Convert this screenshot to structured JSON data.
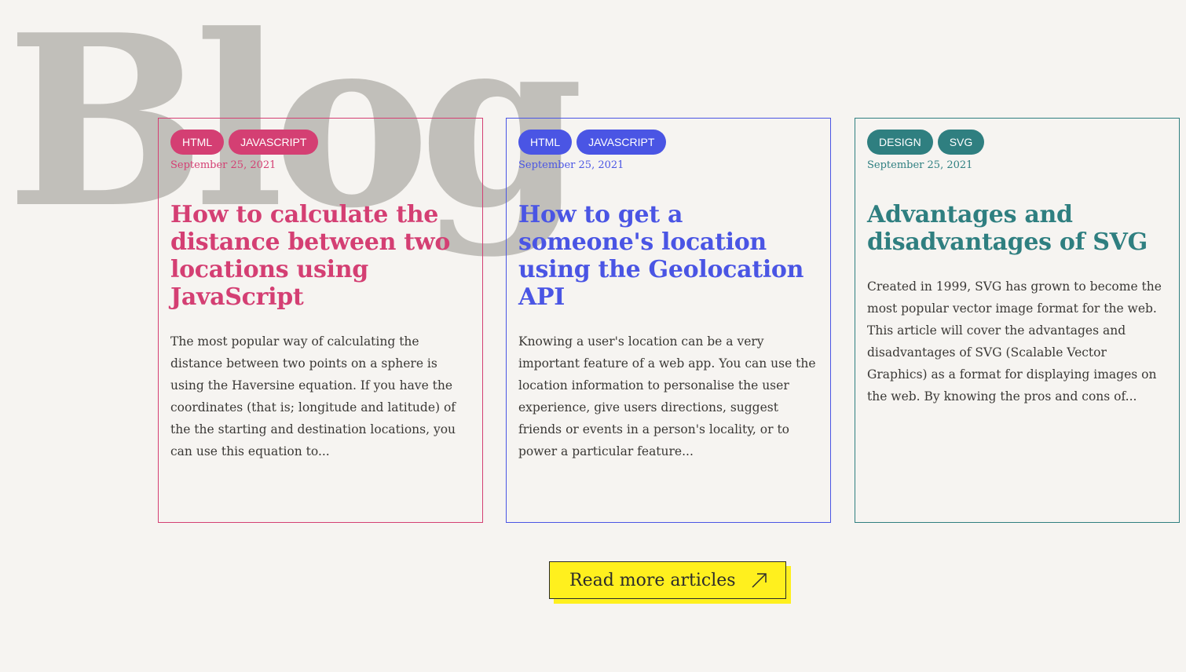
{
  "page": {
    "heading": "Blog"
  },
  "articles": [
    {
      "tags": [
        "HTML",
        "JAVASCRIPT"
      ],
      "date": "September 25, 2021",
      "title": "How to calculate the distance between two locations using JavaScript",
      "excerpt": "The most popular way of calculating the distance between two points on a sphere is using the Haversine equation. If you have the coordinates (that is; longitude and latitude) of the the starting and destination locations, you can use this equation to...",
      "color": "#d43f73"
    },
    {
      "tags": [
        "HTML",
        "JAVASCRIPT"
      ],
      "date": "September 25, 2021",
      "title": "How to get a someone's location using the Geolocation API",
      "excerpt": "Knowing a user's location can be a very important feature of a web app. You can use the location information to personalise the user experience, give users directions, suggest friends or events in a person's locality, or to power a particular feature...",
      "color": "#4a55e4"
    },
    {
      "tags": [
        "DESIGN",
        "SVG"
      ],
      "date": "September 25, 2021",
      "title": "Advantages and disadvantages of SVG",
      "excerpt": "Created in 1999, SVG has grown to become the most popular vector image format for the web. This article will cover the advantages and disadvantages of SVG (Scalable Vector Graphics) as a format for displaying images on the web. By knowing the pros and cons of...",
      "color": "#2f7f80"
    }
  ],
  "cta": {
    "label": "Read more articles",
    "icon": "arrow-up-right-icon",
    "color": "#fff01e"
  }
}
